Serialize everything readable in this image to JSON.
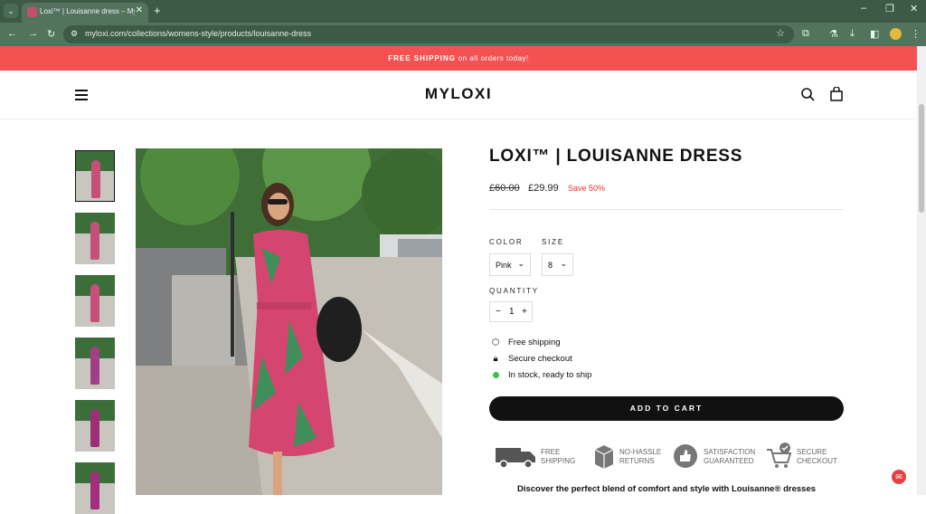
{
  "browser": {
    "tab_title": "Loxi™ | Louisanne dress – Mylo",
    "url": "myloxi.com/collections/womens-style/products/louisanne-dress"
  },
  "banner": {
    "bold": "FREE SHIPPING",
    "rest": "on all orders today!"
  },
  "header": {
    "logo": "MYLOXI"
  },
  "product": {
    "title": "LOXI™ | LOUISANNE DRESS",
    "price_old": "£60.00",
    "price_new": "£29.99",
    "save_label": "Save 50%",
    "color_label": "COLOR",
    "color_value": "Pink",
    "size_label": "SIZE",
    "size_value": "8",
    "quantity_label": "QUANTITY",
    "quantity_value": "1",
    "features": [
      "Free shipping",
      "Secure checkout",
      "In stock, ready to ship"
    ],
    "add_to_cart": "ADD TO CART",
    "badges": [
      {
        "line1": "FREE",
        "line2": "SHIPPING"
      },
      {
        "line1": "NO-HASSLE",
        "line2": "RETURNS"
      },
      {
        "line1": "SATISFACTION",
        "line2": "GUARANTEED"
      },
      {
        "line1": "SECURE",
        "line2": "CHECKOUT"
      }
    ],
    "discover": "Discover the perfect blend of comfort and style with Louisanne® dresses"
  },
  "colors": {
    "banner": "#f45152",
    "save": "#e3322f",
    "stock_dot": "#3fbf4f",
    "button": "#111111"
  }
}
